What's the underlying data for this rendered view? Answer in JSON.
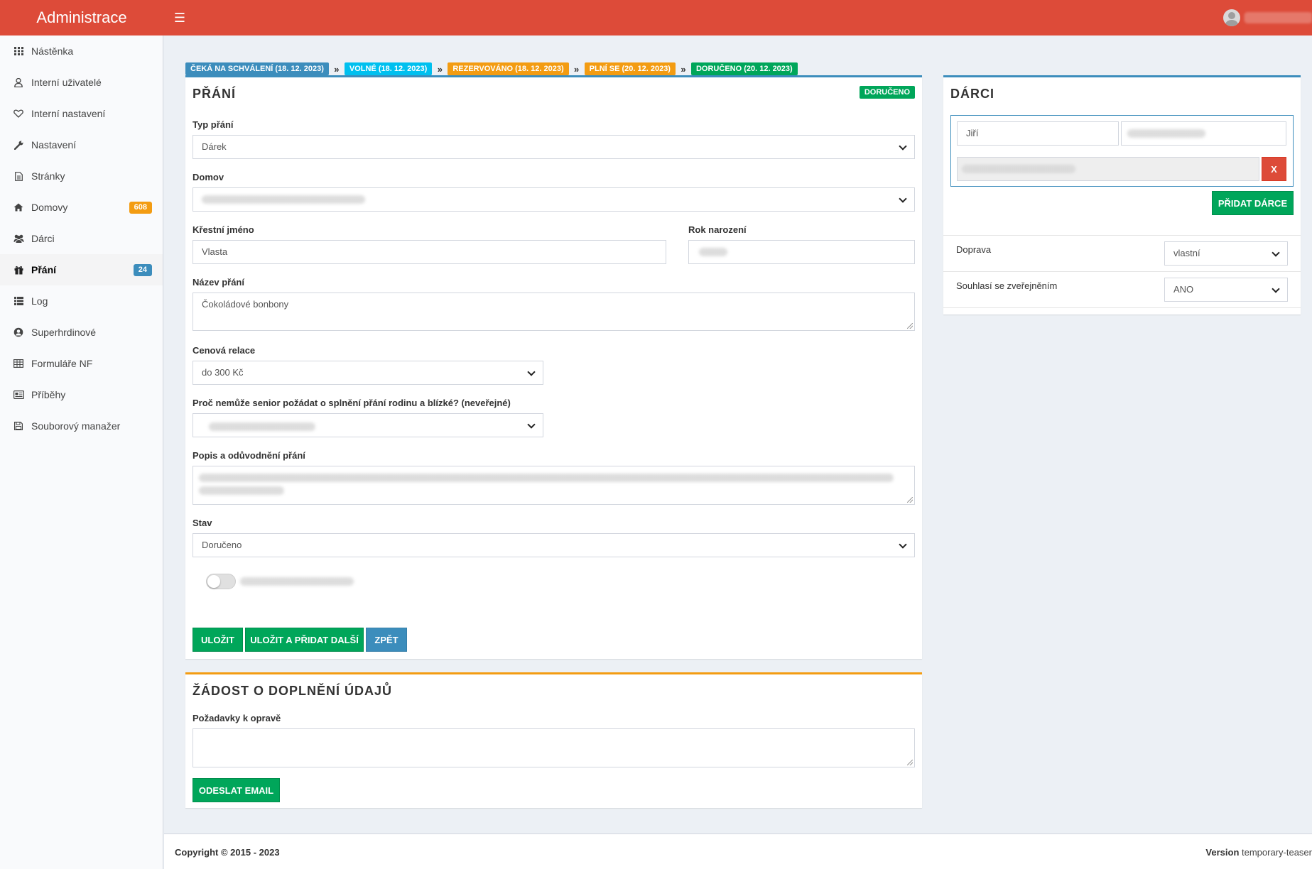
{
  "app": {
    "title": "Administrace"
  },
  "sidebar": {
    "items": [
      {
        "label": "Nástěnka",
        "icon": "grid-icon"
      },
      {
        "label": "Interní uživatelé",
        "icon": "user-icon"
      },
      {
        "label": "Interní nastavení",
        "icon": "heart-icon"
      },
      {
        "label": "Nastavení",
        "icon": "wrench-icon"
      },
      {
        "label": "Stránky",
        "icon": "file-icon"
      },
      {
        "label": "Domovy",
        "icon": "home-icon",
        "badge": "608"
      },
      {
        "label": "Dárci",
        "icon": "users-icon"
      },
      {
        "label": "Přání",
        "icon": "gift-icon",
        "badge": "24",
        "active": true
      },
      {
        "label": "Log",
        "icon": "list-icon"
      },
      {
        "label": "Superhrdinové",
        "icon": "user-circle-icon"
      },
      {
        "label": "Formuláře NF",
        "icon": "table-icon"
      },
      {
        "label": "Příběhy",
        "icon": "newspaper-icon"
      },
      {
        "label": "Souborový manažer",
        "icon": "save-icon"
      }
    ]
  },
  "steps": [
    "ČEKÁ NA SCHVÁLENÍ (18. 12. 2023)",
    "VOLNÉ (18. 12. 2023)",
    "REZERVOVÁNO (18. 12. 2023)",
    "PLNÍ SE (20. 12. 2023)",
    "DORUČENO (20. 12. 2023)"
  ],
  "wish_box": {
    "title": "PŘÁNÍ",
    "status": "DORUČENO",
    "fields": {
      "type_label": "Typ přání",
      "type_value": "Dárek",
      "home_label": "Domov",
      "firstname_label": "Křestní jméno",
      "firstname_value": "Vlasta",
      "birth_year_label": "Rok narození",
      "wish_name_label": "Název přání",
      "wish_name_value": "Čokoládové bonbony",
      "price_label": "Cenová relace",
      "price_value": "do 300 Kč",
      "reason_label": "Proč nemůže senior požádat o splnění přání rodinu a blízké? (neveřejné)",
      "description_label": "Popis a odůvodnění přání",
      "state_label": "Stav",
      "state_value": "Doručeno"
    },
    "buttons": {
      "save": "ULOŽIT",
      "save_add": "ULOŽIT A PŘIDAT DALŠÍ",
      "back": "ZPĚT"
    }
  },
  "request_box": {
    "title": "ŽÁDOST O DOPLNĚNÍ ÚDAJŮ",
    "corrections_label": "Požadavky k opravě",
    "send_button": "ODESLAT EMAIL"
  },
  "donors_box": {
    "title": "DÁRCI",
    "donor_first_name": "Jiří",
    "remove_button": "X",
    "add_button": "PŘIDAT DÁRCE",
    "transport_label": "Doprava",
    "transport_value": "vlastní",
    "consent_label": "Souhlasí se zveřejněním",
    "consent_value": "ANO"
  },
  "footer": {
    "copyright": "Copyright © 2015 - 2023",
    "version_label": "Version",
    "version_value": "temporary-teaser"
  },
  "colors": {
    "header": "#dd4b39",
    "primary": "#3c8dbc",
    "aqua": "#00c0ef",
    "orange": "#f39c12",
    "green": "#00a65a"
  }
}
